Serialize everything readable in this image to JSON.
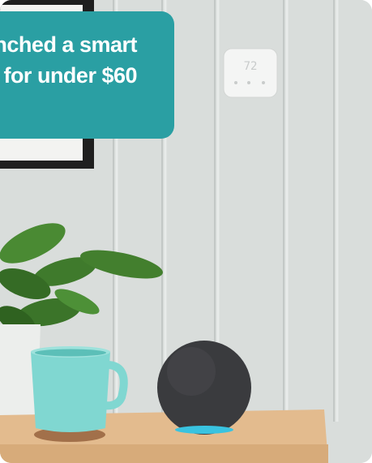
{
  "headline": {
    "line1": "nched a smart",
    "line2": "for under $60"
  },
  "thermostat": {
    "temperature": "72"
  },
  "colors": {
    "banner": "#2a9fa3",
    "wall": "#d8dcd9",
    "table": "#e2b98c",
    "mug": "#7fd6d0",
    "speaker": "#3a3b3e",
    "leaves": "#3f7a2c"
  }
}
